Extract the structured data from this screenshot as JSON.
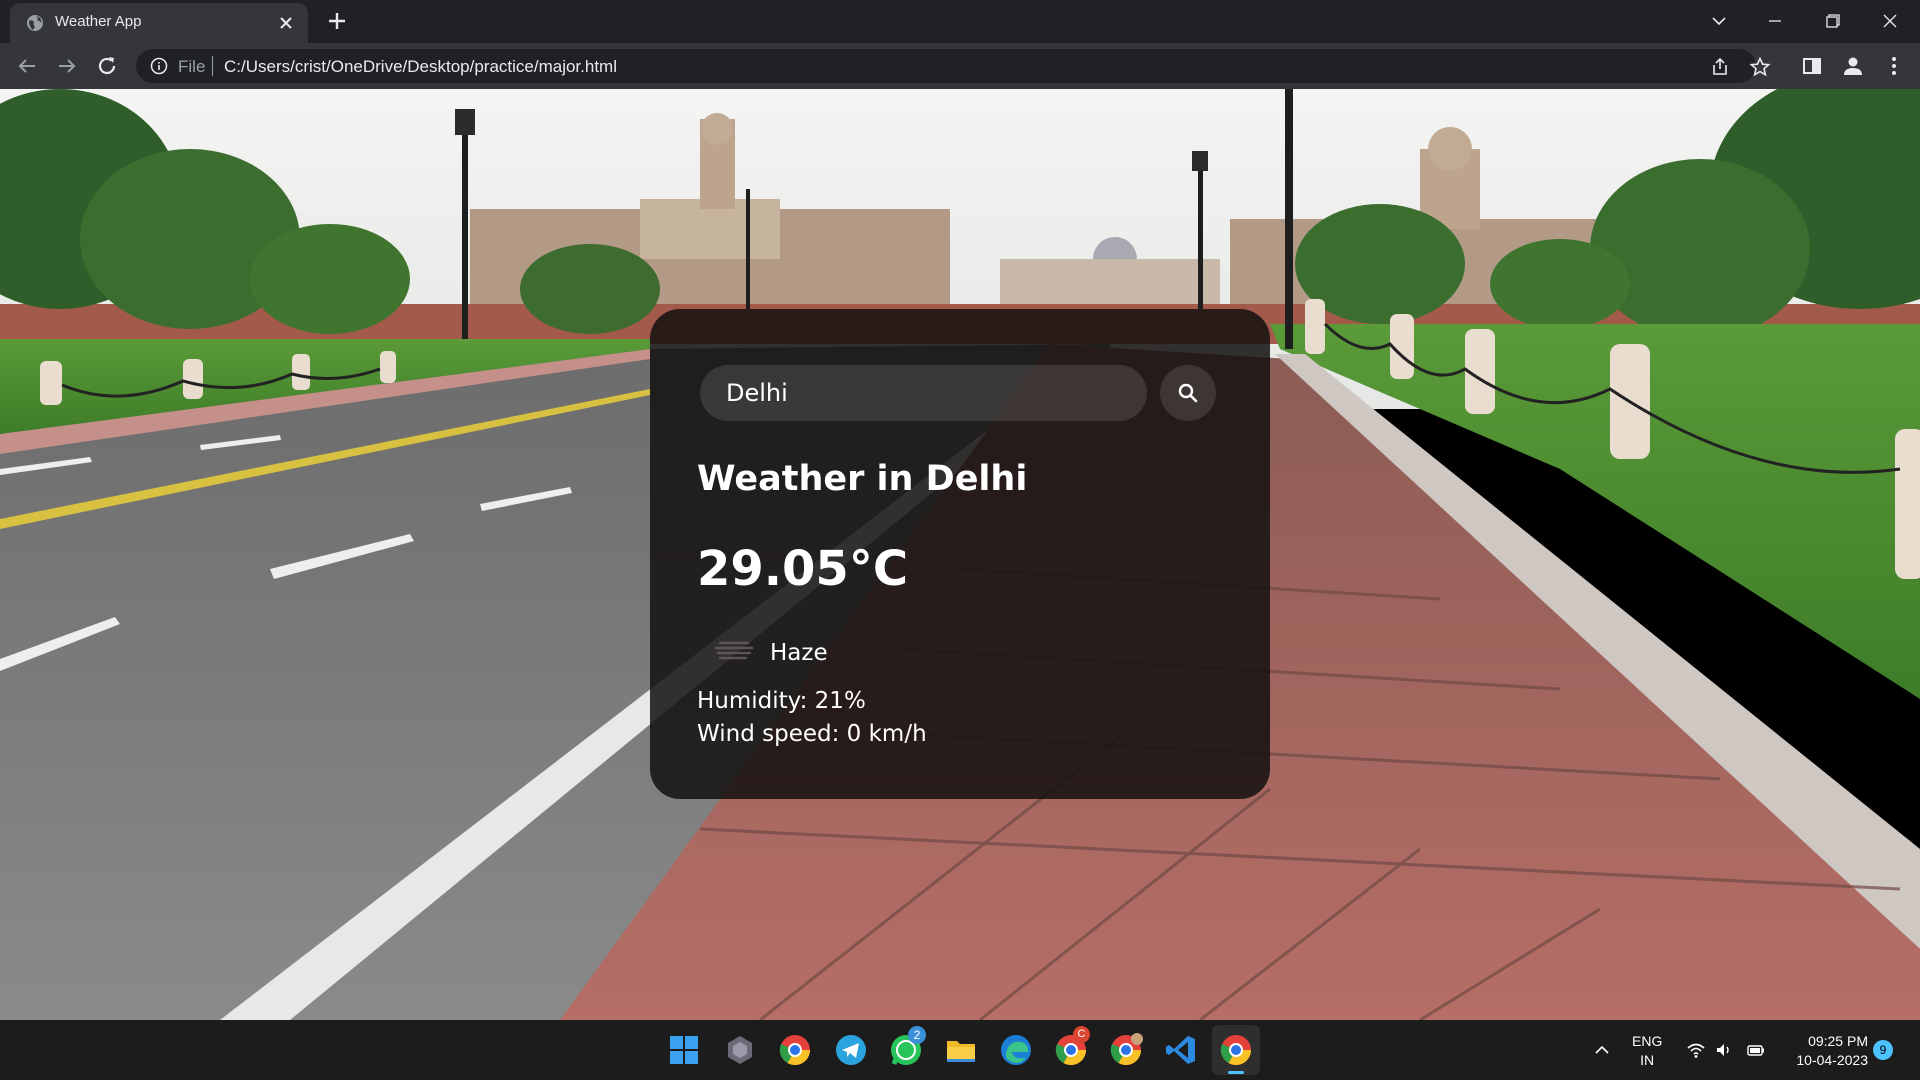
{
  "browser": {
    "tab_title": "Weather App",
    "url_scheme": "File",
    "url": "C:/Users/crist/OneDrive/Desktop/practice/major.html"
  },
  "weather_card": {
    "search_value": "Delhi",
    "heading": "Weather in Delhi",
    "temperature": "29.05°C",
    "condition_icon": "haze-icon",
    "condition": "Haze",
    "humidity": "Humidity: 21%",
    "wind": "Wind speed: 0 km/h"
  },
  "taskbar": {
    "apps": [
      "start-icon",
      "widgets-icon",
      "chrome-icon",
      "telegram-icon",
      "whatsapp-icon",
      "file-explorer-icon",
      "edge-icon",
      "chrome-profile-icon",
      "chrome-profile-2-icon",
      "vscode-icon",
      "chrome-active-icon"
    ],
    "whatsapp_badge": "2",
    "chrome_profile_badge": "C",
    "language_line1": "ENG",
    "language_line2": "IN",
    "time": "09:25 PM",
    "date": "10-04-2023",
    "notification_count": "9"
  },
  "colors": {
    "card_background": "#141010",
    "taskbar_background": "#1c1c1c",
    "browser_frame": "#202124",
    "browser_toolbar": "#35363a"
  }
}
